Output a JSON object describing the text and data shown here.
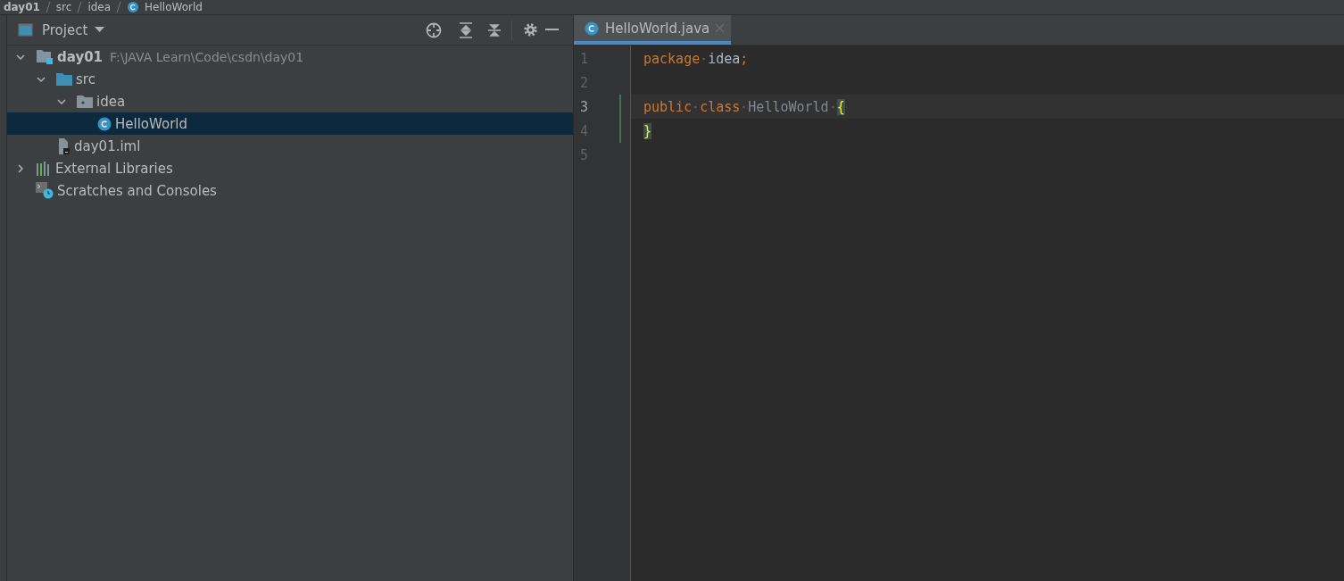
{
  "breadcrumb": [
    {
      "label": "day01",
      "kind": "module"
    },
    {
      "label": "src",
      "kind": "plain"
    },
    {
      "label": "idea",
      "kind": "plain"
    },
    {
      "label": "HelloWorld",
      "kind": "class"
    }
  ],
  "project_panel": {
    "title": "Project"
  },
  "tree": [
    {
      "label": "day01",
      "path": "F:\\JAVA Learn\\Code\\csdn\\day01",
      "kind": "module",
      "expanded": true,
      "selected": false,
      "children": [
        {
          "label": "src",
          "kind": "source",
          "expanded": true,
          "selected": false,
          "children": [
            {
              "label": "idea",
              "kind": "package",
              "expanded": true,
              "selected": false,
              "children": [
                {
                  "label": "HelloWorld",
                  "kind": "class",
                  "selected": true
                }
              ]
            }
          ]
        },
        {
          "label": "day01.iml",
          "kind": "iml",
          "selected": false
        }
      ]
    },
    {
      "label": "External Libraries",
      "kind": "libraries",
      "expanded": false,
      "selected": false
    },
    {
      "label": "Scratches and Consoles",
      "kind": "scratches",
      "selected": false
    }
  ],
  "editor_tabs": [
    {
      "label": "HelloWorld.java",
      "selected": true
    }
  ],
  "code_lines": [
    {
      "number": "1",
      "current": false,
      "changed": false,
      "tokens": [
        {
          "text": "package",
          "kind": "keyword"
        },
        {
          "text": "idea",
          "kind": "ident"
        },
        {
          "text": ";",
          "kind": "keyword"
        }
      ]
    },
    {
      "number": "2",
      "current": false,
      "changed": false
    },
    {
      "number": "3",
      "current": true,
      "changed": true,
      "tokens": [
        {
          "text": "public",
          "kind": "keyword"
        },
        {
          "text": "class",
          "kind": "keyword"
        },
        {
          "text": "HelloWorld",
          "kind": "name"
        },
        {
          "text": "{",
          "kind": "brace"
        }
      ]
    },
    {
      "number": "4",
      "current": false,
      "changed": true,
      "tokens": [
        {
          "text": "}",
          "kind": "brace"
        }
      ]
    },
    {
      "number": "5",
      "current": false,
      "changed": false
    }
  ]
}
